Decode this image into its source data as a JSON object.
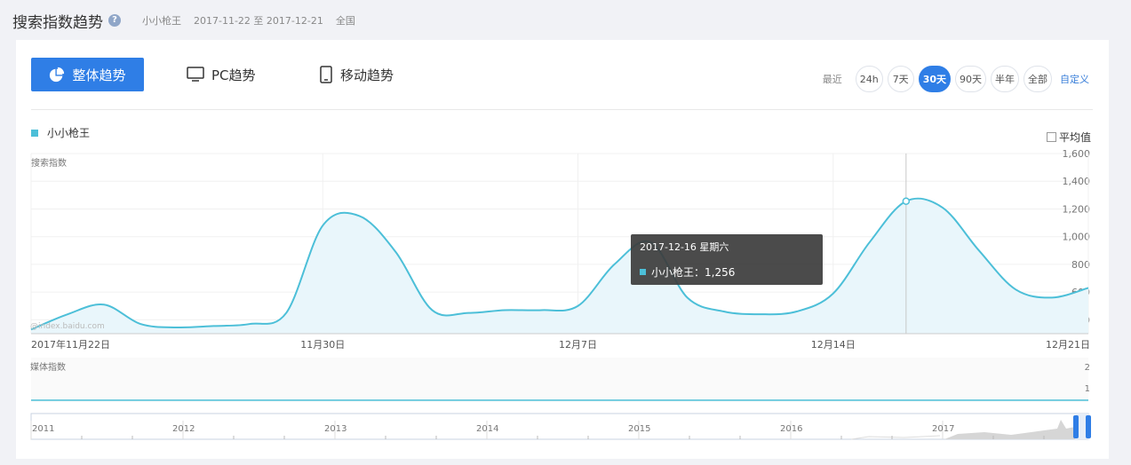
{
  "header": {
    "title": "搜索指数趋势",
    "keyword": "小小枪王",
    "date_range": "2017-11-22 至 2017-12-21",
    "region": "全国"
  },
  "tabs": {
    "overall": "整体趋势",
    "pc": "PC趋势",
    "mobile": "移动趋势"
  },
  "range": {
    "label": "最近",
    "options": [
      "24h",
      "7天",
      "30天",
      "90天",
      "半年",
      "全部"
    ],
    "active": "30天",
    "custom": "自定义"
  },
  "legend": {
    "series_name": "小小枪王",
    "average_label": "平均值",
    "series_color": "#4cbfd8"
  },
  "chart_data": {
    "type": "area",
    "ylabel": "搜索指数",
    "ylim": [
      300,
      1600
    ],
    "yticks": [
      "400",
      "600",
      "800",
      "1,000",
      "1,200",
      "1,400",
      "1,600"
    ],
    "x": [
      "2017-11-22",
      "2017-11-23",
      "2017-11-24",
      "2017-11-25",
      "2017-11-26",
      "2017-11-27",
      "2017-11-28",
      "2017-11-29",
      "2017-11-30",
      "2017-12-01",
      "2017-12-02",
      "2017-12-03",
      "2017-12-04",
      "2017-12-05",
      "2017-12-06",
      "2017-12-07",
      "2017-12-08",
      "2017-12-09",
      "2017-12-10",
      "2017-12-11",
      "2017-12-12",
      "2017-12-13",
      "2017-12-14",
      "2017-12-15",
      "2017-12-16",
      "2017-12-17",
      "2017-12-18",
      "2017-12-19",
      "2017-12-20",
      "2017-12-21"
    ],
    "xticks": [
      {
        "index": 0,
        "label": "2017年11月22日"
      },
      {
        "index": 8,
        "label": "11月30日"
      },
      {
        "index": 15,
        "label": "12月7日"
      },
      {
        "index": 22,
        "label": "12月14日"
      },
      {
        "index": 29,
        "label": "12月21日"
      }
    ],
    "series": [
      {
        "name": "小小枪王",
        "values": [
          330,
          440,
          510,
          370,
          345,
          355,
          370,
          450,
          1080,
          1150,
          890,
          470,
          450,
          470,
          470,
          500,
          800,
          960,
          560,
          460,
          440,
          460,
          590,
          960,
          1256,
          1210,
          900,
          620,
          560,
          630
        ]
      }
    ],
    "tooltip": {
      "date": "2017-12-16 星期六",
      "label": "小小枪王：1,256",
      "index": 24
    }
  },
  "media": {
    "label": "媒体指数",
    "yticks": [
      "2",
      "1"
    ]
  },
  "timeline": {
    "years": [
      "2011",
      "2012",
      "2013",
      "2014",
      "2015",
      "2016",
      "2017"
    ]
  },
  "watermark": "@index.baidu.com"
}
